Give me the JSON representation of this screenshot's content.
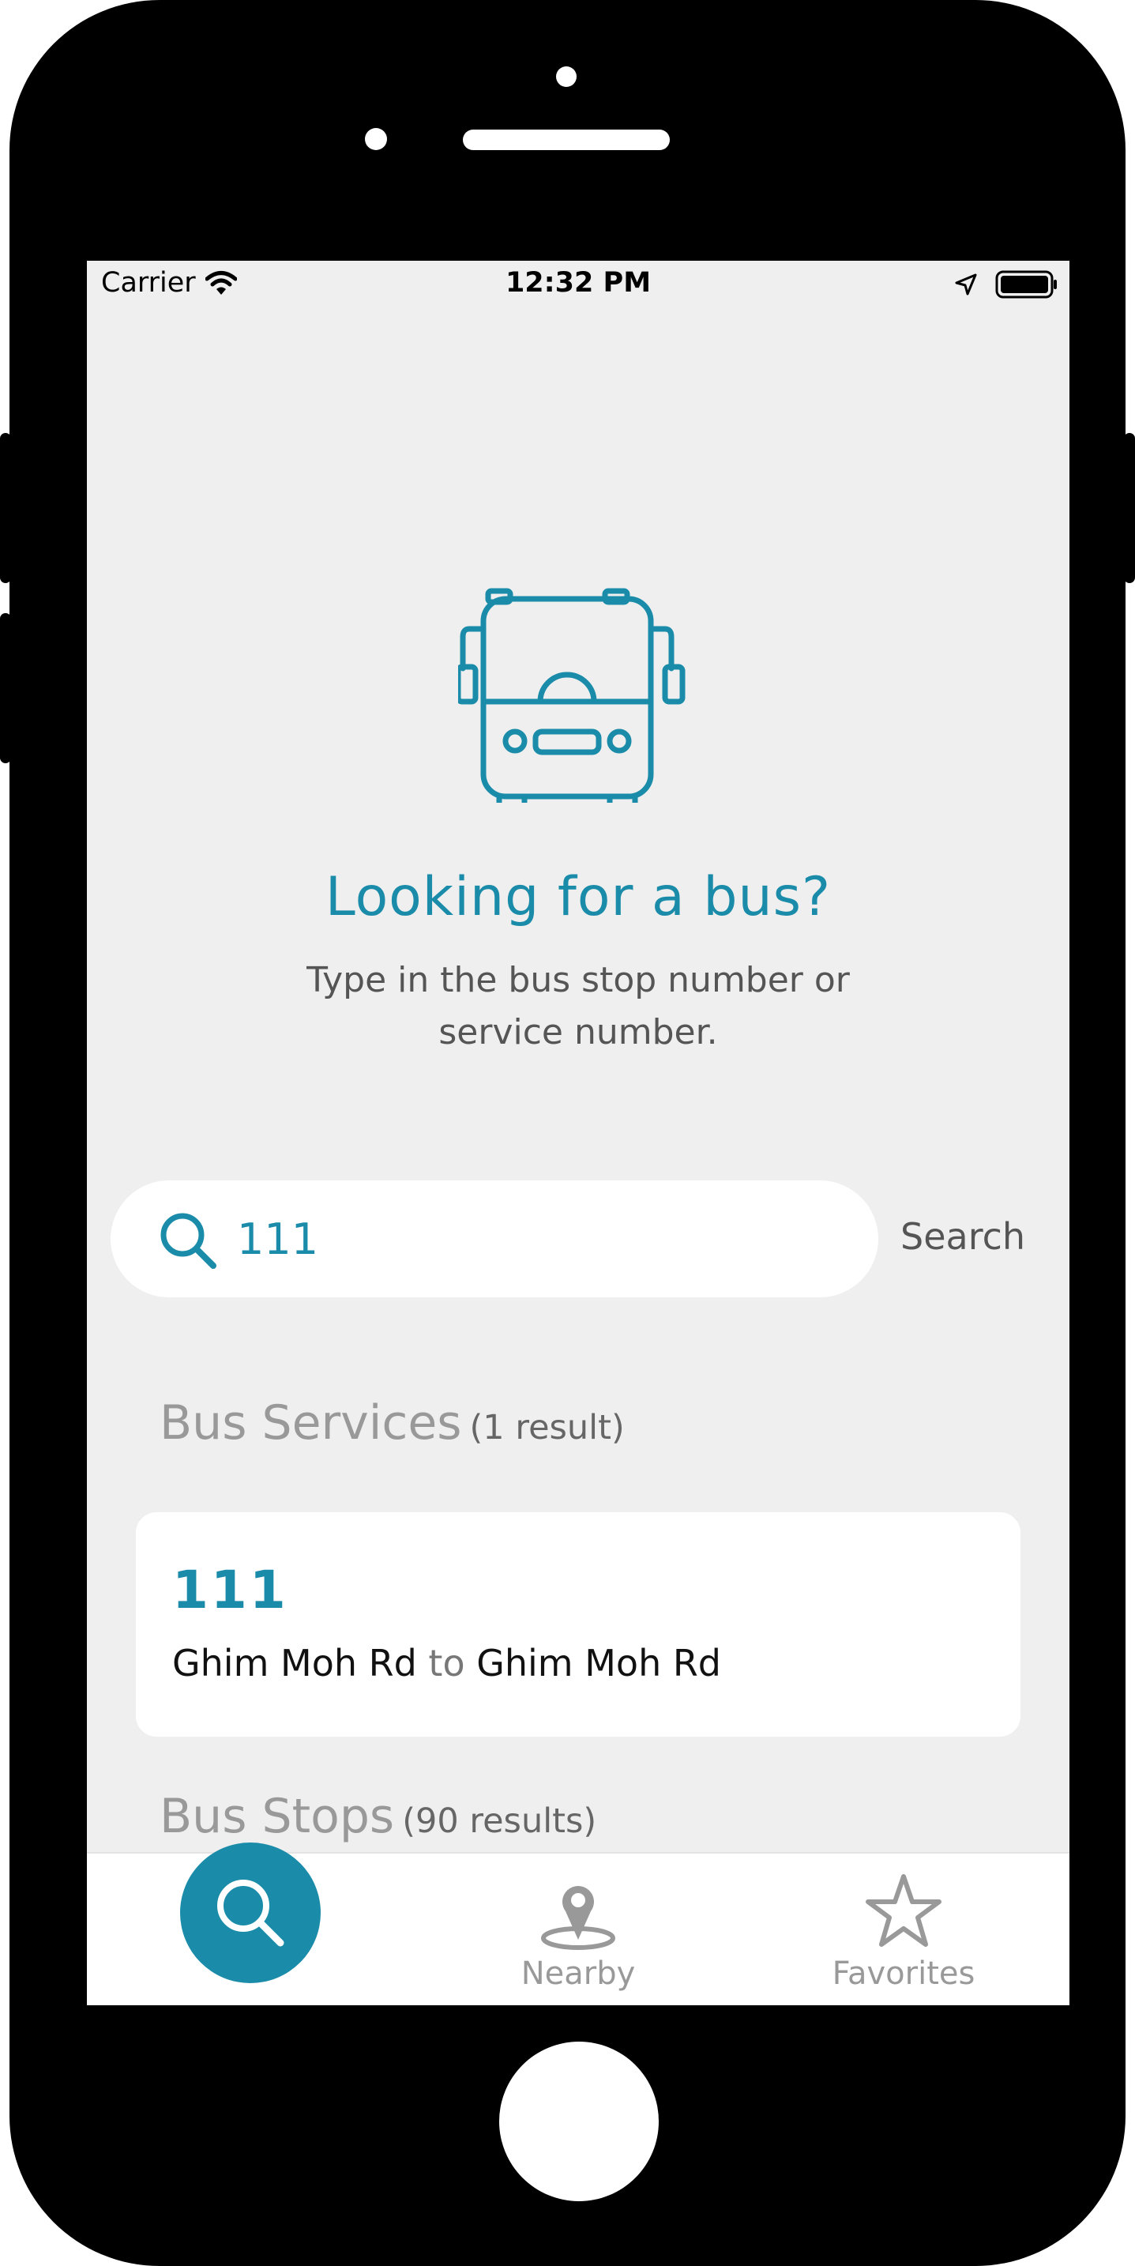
{
  "status_bar": {
    "carrier": "Carrier",
    "time": "12:32 PM"
  },
  "hero": {
    "icon": "bus-icon",
    "title": "Looking for a bus?",
    "subtitle": "Type in the bus stop number or service number."
  },
  "search": {
    "value": "111",
    "button_label": "Search"
  },
  "bus_services": {
    "heading": "Bus Services",
    "count": "(1 result)",
    "results": [
      {
        "number": "111",
        "from": "Ghim Moh Rd",
        "connector": "to",
        "to": "Ghim Moh Rd"
      }
    ]
  },
  "bus_stops": {
    "heading": "Bus Stops",
    "count": "(90 results)"
  },
  "tab_bar": {
    "tabs": [
      {
        "icon": "search-icon",
        "label": "",
        "active": true
      },
      {
        "icon": "map-pin-icon",
        "label": "Nearby"
      },
      {
        "icon": "star-icon",
        "label": "Favorites"
      }
    ]
  },
  "colors": {
    "accent": "#1a8ca9",
    "background": "#efefef",
    "muted_text": "#999999"
  }
}
